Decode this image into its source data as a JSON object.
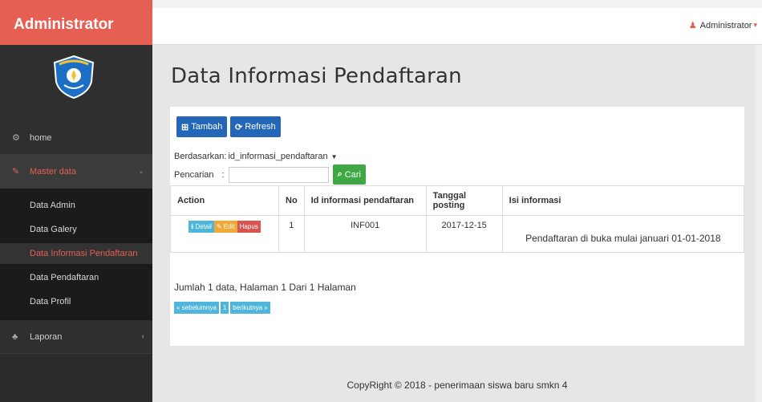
{
  "sidebar": {
    "brand": "Administrator",
    "home": "home",
    "master": "Master data",
    "subitems": [
      "Data Admin",
      "Data Galery",
      "Data Informasi Pendaftaran",
      "Data Pendaftaran",
      "Data Profil"
    ],
    "laporan": "Laporan"
  },
  "topbar": {
    "user": "Administrator"
  },
  "main": {
    "title": "Data Informasi Pendaftaran",
    "btn_add": "Tambah",
    "btn_refresh": "Refresh",
    "filter_label": "Berdasarkan:",
    "filter_value": "id_informasi_pendaftaran",
    "search_label": "Pencarian",
    "search_colon": ":",
    "search_value": "",
    "btn_search": "Cari",
    "table": {
      "headers": [
        "Action",
        "No",
        "Id informasi pendaftaran",
        "Tanggal posting",
        "Isi informasi"
      ],
      "rows": [
        {
          "no": "1",
          "id": "INF001",
          "date": "2017-12-15",
          "isi": "Pendaftaran di buka mulai januari 01-01-2018"
        }
      ],
      "actions": {
        "detail": "Detail",
        "edit": "Edit",
        "hapus": "Hapus"
      }
    },
    "summary": "Jumlah 1 data, Halaman 1 Dari 1 Halaman",
    "pager": {
      "prev": "« sebelumnya",
      "page": "1",
      "next": "berikutnya »"
    }
  },
  "footer": "CopyRight © 2018 - penerimaan siswa baru smkn 4",
  "colors": {
    "brand": "#e55f52",
    "primary": "#2466b8",
    "success": "#3fa845",
    "info": "#4db6da",
    "warning": "#f0a838",
    "danger": "#d9534f"
  }
}
